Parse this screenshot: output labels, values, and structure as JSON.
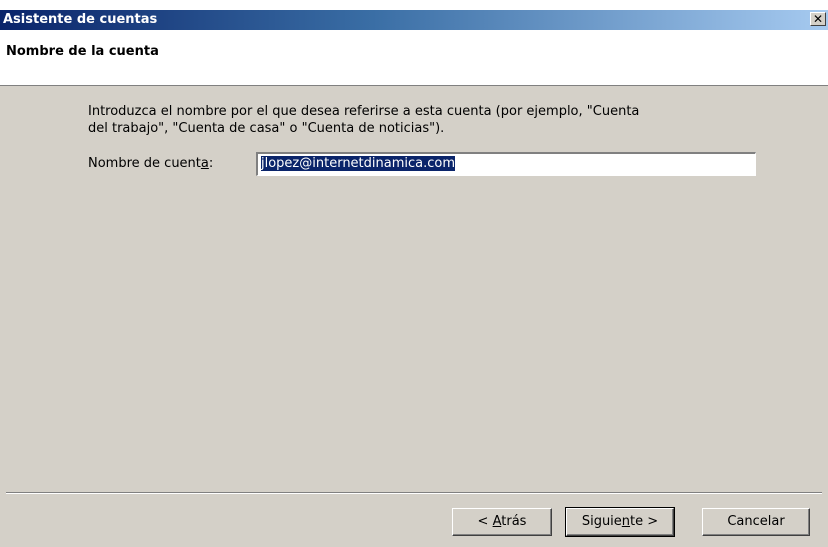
{
  "window": {
    "title": "Asistente de cuentas",
    "close_glyph": "✕"
  },
  "header": {
    "title": "Nombre de la cuenta"
  },
  "body": {
    "intro_line1": "Introduzca el nombre por el que desea referirse a esta cuenta (por ejemplo, \"Cuenta",
    "intro_line2": "del trabajo\", \"Cuenta de casa\" o \"Cuenta de noticias\").",
    "field_label_pre": "Nombre de cuent",
    "field_label_accel": "a",
    "field_label_post": ":",
    "field_value": "jlopez@internetdinamica.com"
  },
  "buttons": {
    "back_pre": "< ",
    "back_accel": "A",
    "back_post": "trás",
    "next_pre": "Siguie",
    "next_accel": "n",
    "next_post": "te >",
    "cancel": "Cancelar"
  },
  "colors": {
    "titlebar_start": "#0a246a",
    "titlebar_end": "#a6caf0",
    "face": "#d4d0c8",
    "selection": "#0a246a"
  }
}
